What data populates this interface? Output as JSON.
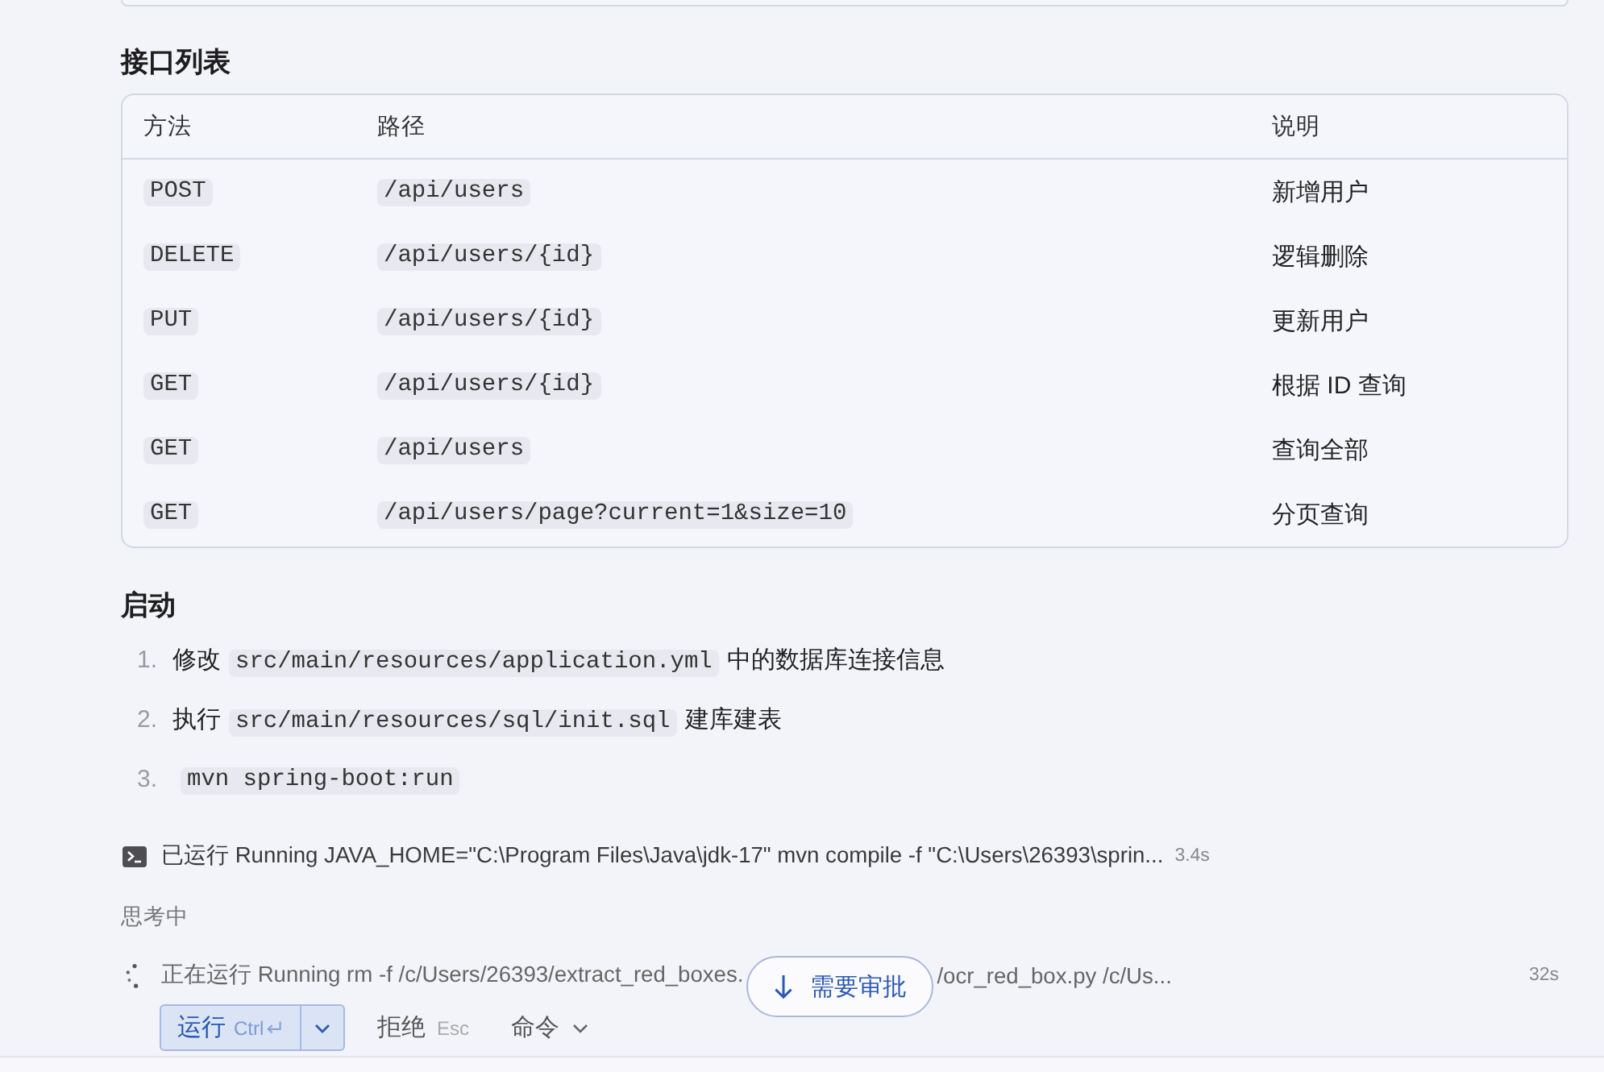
{
  "api_section": {
    "heading": "接口列表",
    "table": {
      "columns": [
        "方法",
        "路径",
        "说明"
      ],
      "rows": [
        {
          "method": "POST",
          "path": "/api/users",
          "description": "新增用户"
        },
        {
          "method": "DELETE",
          "path": "/api/users/{id}",
          "description": "逻辑删除"
        },
        {
          "method": "PUT",
          "path": "/api/users/{id}",
          "description": "更新用户"
        },
        {
          "method": "GET",
          "path": "/api/users/{id}",
          "description": "根据 ID 查询"
        },
        {
          "method": "GET",
          "path": "/api/users",
          "description": "查询全部"
        },
        {
          "method": "GET",
          "path": "/api/users/page?current=1&size=10",
          "description": "分页查询"
        }
      ]
    }
  },
  "startup_section": {
    "heading": "启动",
    "steps": [
      {
        "number": "1.",
        "segments": [
          {
            "kind": "text",
            "text": "修改"
          },
          {
            "kind": "code",
            "text": "src/main/resources/application.yml"
          },
          {
            "kind": "text",
            "text": "中的数据库连接信息"
          }
        ]
      },
      {
        "number": "2.",
        "segments": [
          {
            "kind": "text",
            "text": "执行"
          },
          {
            "kind": "code",
            "text": "src/main/resources/sql/init.sql"
          },
          {
            "kind": "text",
            "text": "建库建表"
          }
        ]
      },
      {
        "number": "3.",
        "segments": [
          {
            "kind": "code",
            "text": "mvn spring-boot:run"
          }
        ]
      }
    ]
  },
  "activity_log": [
    {
      "kind": "command_done",
      "text": "已运行 Running JAVA_HOME=\"C:\\Program Files\\Java\\jdk-17\" mvn compile -f \"C:\\Users\\26393\\sprin...",
      "duration": "3.4s"
    },
    {
      "kind": "status",
      "text": "思考中"
    },
    {
      "kind": "command_running",
      "text": "正在运行 Running rm -f /c/Users/26393/extract_red_boxes.",
      "text_continued": "/ocr_red_box.py /c/Us...",
      "duration": "32s"
    }
  ],
  "jump_button": {
    "label": "需要审批"
  },
  "approval_actions": {
    "run_button": {
      "label": "运行",
      "shortcut": "Ctrl"
    },
    "reject_button": {
      "label": "拒绝",
      "shortcut": "Esc"
    },
    "command_menu": {
      "label": "命令"
    }
  }
}
